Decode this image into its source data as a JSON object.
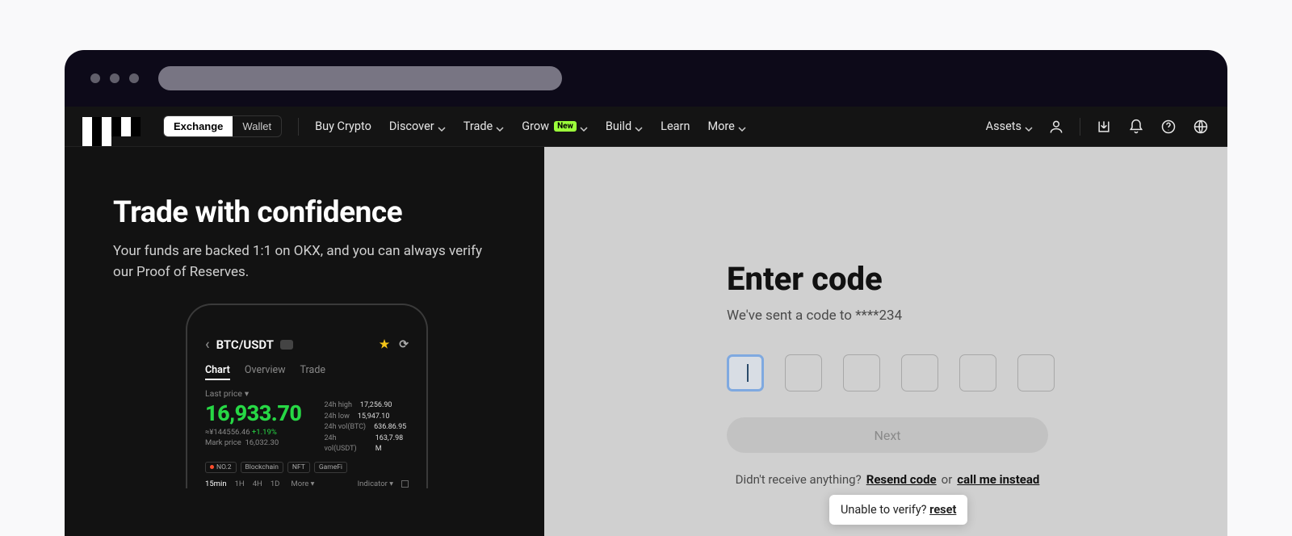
{
  "nav": {
    "segmented": {
      "exchange": "Exchange",
      "wallet": "Wallet"
    },
    "links": {
      "buy": "Buy Crypto",
      "discover": "Discover",
      "trade": "Trade",
      "grow": "Grow",
      "grow_badge": "New",
      "build": "Build",
      "learn": "Learn",
      "more": "More"
    },
    "assets": "Assets"
  },
  "hero": {
    "title": "Trade with confidence",
    "subtitle": "Your funds are backed 1:1 on OKX, and you can always verify our Proof of Reserves."
  },
  "phone": {
    "pair": "BTC/USDT",
    "tabs": {
      "chart": "Chart",
      "overview": "Overview",
      "trade": "Trade"
    },
    "price_label": "Last price",
    "price": "16,933.70",
    "sub_price_cny": "≈¥144556.46",
    "sub_price_change": "+1.19%",
    "mark_price_label": "Mark price",
    "mark_price_value": "16,032.30",
    "stats": {
      "high_label": "24h high",
      "high": "17,256.90",
      "low_label": "24h low",
      "low": "15,947.10",
      "volbtc_label": "24h vol(BTC)",
      "volbtc": "636.86.95",
      "volusdt_label": "24h vol(USDT)",
      "volusdt": "163,7.98 M"
    },
    "tags": [
      "NO.2",
      "Blockchain",
      "NFT",
      "GameFi"
    ],
    "timeframes": [
      "15min",
      "1H",
      "4H",
      "1D"
    ],
    "tf_more": "More",
    "indicator": "Indicator"
  },
  "verify": {
    "title": "Enter code",
    "subtitle": "We've sent a code to ****234",
    "next": "Next",
    "noreceive": "Didn't receive anything?",
    "resend": "Resend code",
    "or": "or",
    "call": "call me instead",
    "unable": "Unable to verify?",
    "reset": "reset"
  }
}
